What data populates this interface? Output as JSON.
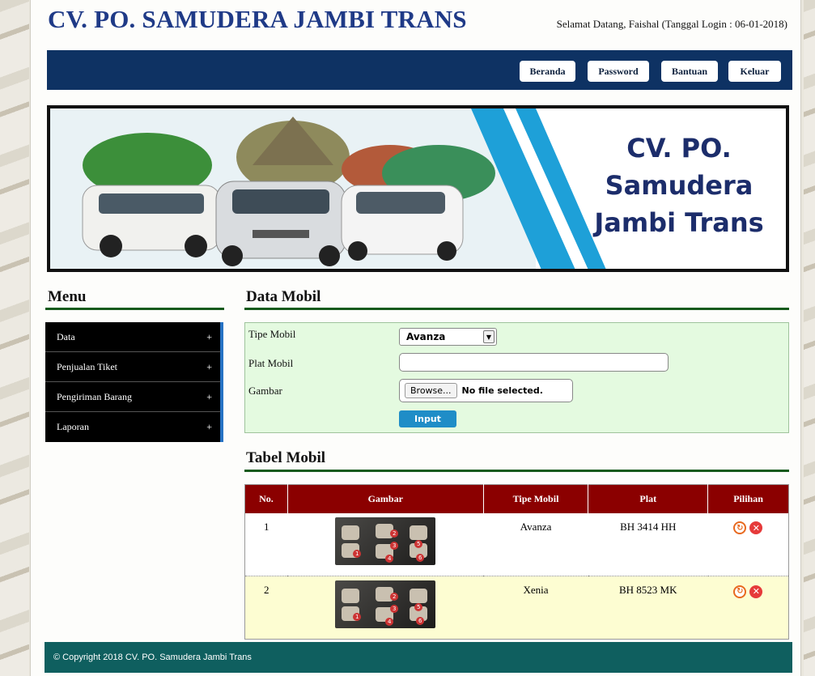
{
  "header": {
    "title": "CV. PO. SAMUDERA JAMBI TRANS",
    "welcome": "Selamat Datang, Faishal (Tanggal Login : 06-01-2018)"
  },
  "nav": {
    "items": [
      "Beranda",
      "Password",
      "Bantuan",
      "Keluar"
    ]
  },
  "banner": {
    "line1": "CV. PO.",
    "line2": "Samudera",
    "line3": "Jambi Trans"
  },
  "sidebar": {
    "title": "Menu",
    "items": [
      {
        "label": "Data",
        "icon": "plus-icon"
      },
      {
        "label": "Penjualan Tiket",
        "icon": "plus-icon"
      },
      {
        "label": "Pengiriman Barang",
        "icon": "plus-icon"
      },
      {
        "label": "Laporan",
        "icon": "plus-icon"
      }
    ],
    "plus_symbol": "+"
  },
  "form": {
    "title": "Data Mobil",
    "tipe_label": "Tipe Mobil",
    "tipe_value": "Avanza",
    "plat_label": "Plat Mobil",
    "plat_value": "",
    "gambar_label": "Gambar",
    "browse_label": "Browse...",
    "file_status": "No file selected.",
    "submit_label": "Input"
  },
  "table": {
    "title": "Tabel Mobil",
    "headers": [
      "No.",
      "Gambar",
      "Tipe Mobil",
      "Plat",
      "Pilihan"
    ],
    "rows": [
      {
        "no": "1",
        "tipe": "Avanza",
        "plat": "BH 3414 HH"
      },
      {
        "no": "2",
        "tipe": "Xenia",
        "plat": "BH 8523 MK"
      }
    ],
    "seat_numbers": [
      "1",
      "2",
      "3",
      "4",
      "5",
      "6"
    ]
  },
  "footer": {
    "copyright": "© Copyright 2018 CV. PO. Samudera Jambi Trans"
  },
  "colors": {
    "brand_blue": "#1f3a87",
    "navbar": "#0e3263",
    "table_header": "#8b0000",
    "form_bg": "#e4fae0",
    "footer": "#0f5f5f"
  }
}
